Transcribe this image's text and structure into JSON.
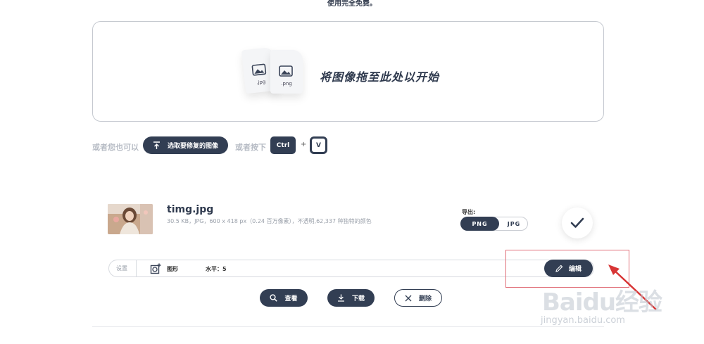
{
  "header": {
    "note": "使用完全免费。"
  },
  "dropzone": {
    "text": "将图像拖至此处以开始",
    "file_icons": [
      {
        "ext": ".jpg"
      },
      {
        "ext": ".png"
      }
    ]
  },
  "upload_row": {
    "or_text": "或者您也可以",
    "choose_button": "选取要修复的图像",
    "or_press": "或者按下",
    "key_ctrl": "Ctrl",
    "plus": "+",
    "key_v": "V"
  },
  "file": {
    "name": "timg.jpg",
    "meta": "30.5 KB，JPG，600 x 418 px（0.24 百万像素），不透明,62,337 种独特的颜色"
  },
  "export": {
    "label": "导出:",
    "options": [
      "PNG",
      "JPG"
    ],
    "selected": "PNG"
  },
  "settings": {
    "label": "设置",
    "shape_label": "图形",
    "level_label": "水平：5",
    "edit_button": "编辑"
  },
  "actions": {
    "view": "查看",
    "download": "下载",
    "delete": "删除"
  },
  "watermark": {
    "brand": "Baidu经验",
    "url": "jingyan.baidu.com"
  },
  "colors": {
    "accent": "#323e53",
    "annotation": "#e1707a"
  }
}
